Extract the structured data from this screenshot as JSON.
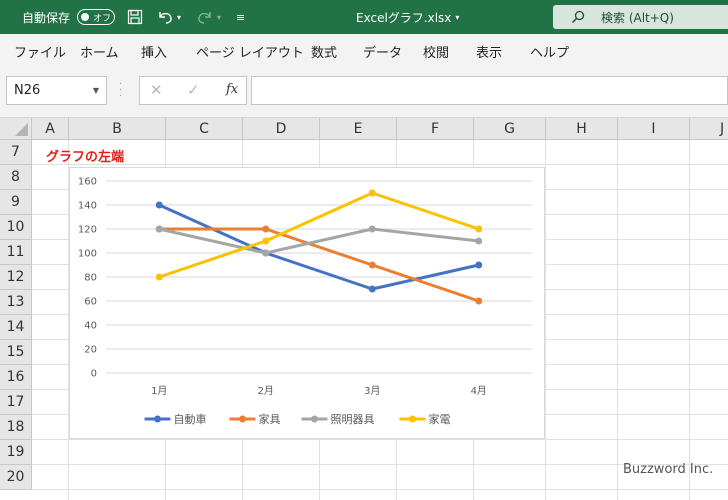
{
  "titlebar": {
    "autosave_label": "自動保存",
    "autosave_state": "オフ",
    "filename": "Excelグラフ.xlsx",
    "search_placeholder": "検索 (Alt+Q)",
    "accent_color": "#217346"
  },
  "menu": [
    "ファイル",
    "ホーム",
    "挿入",
    "ページ レイアウト",
    "数式",
    "データ",
    "校閲",
    "表示",
    "ヘルプ"
  ],
  "formula_bar": {
    "name_box": "N26",
    "fx_label": "fx",
    "formula": ""
  },
  "grid": {
    "columns": [
      "A",
      "B",
      "C",
      "D",
      "E",
      "F",
      "G",
      "H",
      "I",
      "J"
    ],
    "rows": [
      "7",
      "8",
      "9",
      "10",
      "11",
      "12",
      "13",
      "14",
      "15",
      "16",
      "17",
      "18",
      "19",
      "20"
    ],
    "cell_B7": "グラフの左端",
    "cell_B7_color": "#e31b1b"
  },
  "chart_data": {
    "type": "line",
    "categories": [
      "1月",
      "2月",
      "3月",
      "4月"
    ],
    "y_ticks": [
      "0",
      "20",
      "40",
      "60",
      "80",
      "100",
      "120",
      "140",
      "160"
    ],
    "ylim": [
      0,
      160
    ],
    "grid": true,
    "legend": "bottom",
    "series": [
      {
        "name": "自動車",
        "values": [
          140,
          100,
          70,
          90
        ],
        "color": "#4472c4"
      },
      {
        "name": "家具",
        "values": [
          120,
          120,
          90,
          60
        ],
        "color": "#ed7d31"
      },
      {
        "name": "照明器具",
        "values": [
          120,
          100,
          120,
          110
        ],
        "color": "#a5a5a5"
      },
      {
        "name": "家電",
        "values": [
          80,
          110,
          150,
          120
        ],
        "color": "#ffc000"
      }
    ]
  },
  "watermark": "Buzzword Inc."
}
